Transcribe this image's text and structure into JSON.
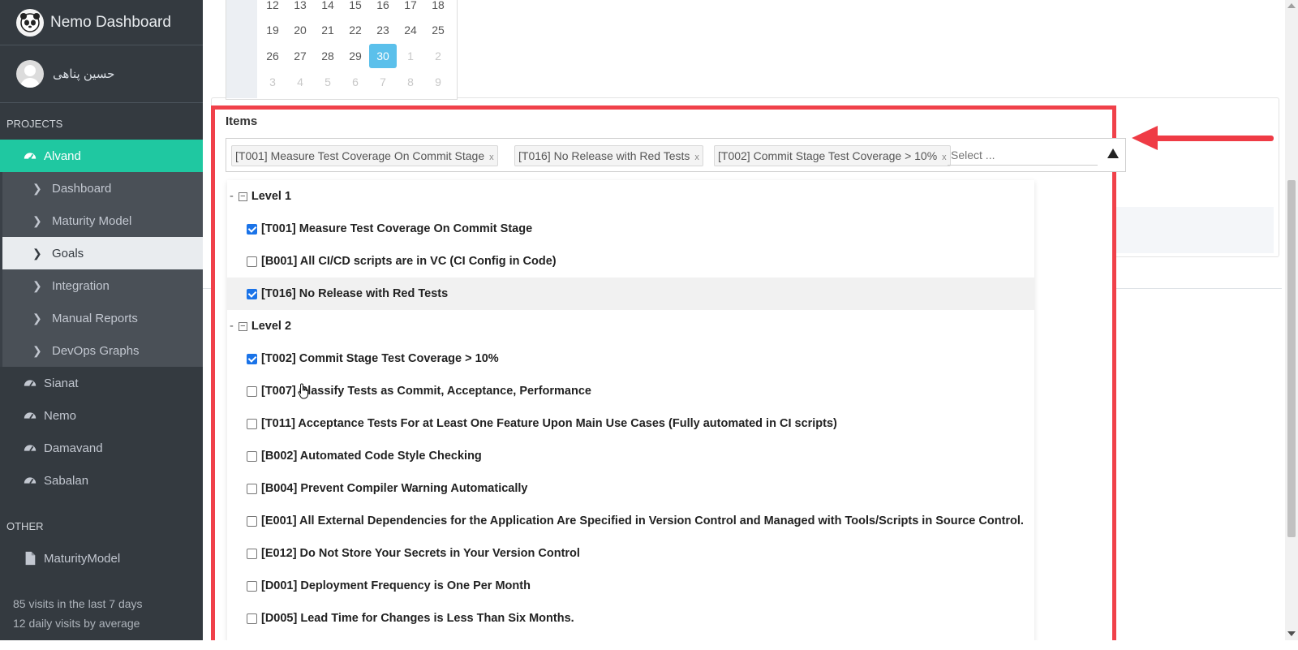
{
  "sidebar": {
    "brand": "Nemo Dashboard",
    "user_name": "حسین پناهی",
    "projects_header": "PROJECTS",
    "active_project": "Alvand",
    "sub_items": [
      "Dashboard",
      "Maturity Model",
      "Goals",
      "Integration",
      "Manual Reports",
      "DevOps Graphs"
    ],
    "projects": [
      "Sianat",
      "Nemo",
      "Damavand",
      "Sabalan"
    ],
    "other_header": "OTHER",
    "other_item": "MaturityModel",
    "visits_week": "85 visits in the last 7 days",
    "visits_daily": "12 daily visits by average"
  },
  "calendar": {
    "rows": [
      [
        "12",
        "13",
        "14",
        "15",
        "16",
        "17",
        "18"
      ],
      [
        "19",
        "20",
        "21",
        "22",
        "23",
        "24",
        "25"
      ],
      [
        "26",
        "27",
        "28",
        "29",
        "30",
        "1",
        "2"
      ],
      [
        "3",
        "4",
        "5",
        "6",
        "7",
        "8",
        "9"
      ]
    ],
    "selected": "30"
  },
  "items_field": {
    "label": "Items",
    "placeholder": "Select ...",
    "tags": [
      "[T001] Measure Test Coverage On Commit Stage",
      "[T016] No Release with Red Tests",
      "[T002] Commit Stage Test Coverage > 10%"
    ],
    "remove_glyph": "x"
  },
  "dropdown": {
    "level1": "Level 1",
    "level2": "Level 2",
    "level1_items": [
      {
        "label": "[T001] Measure Test Coverage On Commit Stage",
        "checked": true
      },
      {
        "label": "[B001] All CI/CD scripts are in VC (CI Config in Code)",
        "checked": false
      },
      {
        "label": "[T016] No Release with Red Tests",
        "checked": true
      }
    ],
    "level2_items": [
      {
        "label": "[T002] Commit Stage Test Coverage > 10%",
        "checked": true
      },
      {
        "label": "[T007] Classify Tests as Commit, Acceptance, Performance",
        "checked": false
      },
      {
        "label": "[T011] Acceptance Tests For at Least One Feature Upon Main Use Cases (Fully automated in CI scripts)",
        "checked": false
      },
      {
        "label": "[B002] Automated Code Style Checking",
        "checked": false
      },
      {
        "label": "[B004] Prevent Compiler Warning Automatically",
        "checked": false
      },
      {
        "label": "[E001] All External Dependencies for the Application Are Specified in Version Control and Managed with Tools/Scripts in Source Control.",
        "checked": false
      },
      {
        "label": "[E012] Do Not Store Your Secrets in Your Version Control",
        "checked": false
      },
      {
        "label": "[D001] Deployment Frequency is One Per Month",
        "checked": false
      },
      {
        "label": "[D005] Lead Time for Changes is Less Than Six Months.",
        "checked": false
      }
    ]
  },
  "colors": {
    "sidebar_bg": "#343a40",
    "active_project": "#1fc8a1",
    "highlight_border": "#f0414a",
    "checkbox_checked": "#1a73e8",
    "today": "#5bc0eb"
  }
}
